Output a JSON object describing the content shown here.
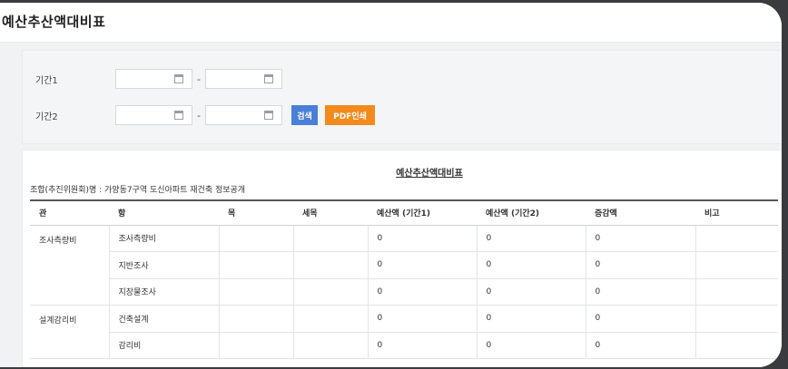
{
  "page": {
    "title": "예산추산액대비표"
  },
  "filter": {
    "period1_label": "기간1",
    "period2_label": "기간2",
    "separator": "-",
    "search_label": "검색",
    "pdf_label": "PDF인쇄"
  },
  "report": {
    "title": "예산추산액대비표",
    "subtitle": "조합(추진위원회)명 : 가양동7구역 도신아파트 재건축 정보공개",
    "columns": [
      "관",
      "항",
      "목",
      "세목",
      "예산액 (기간1)",
      "예산액 (기간2)",
      "증감액",
      "비고"
    ],
    "groups": [
      {
        "name": "조사측량비",
        "rows": [
          {
            "item": "조사측량비",
            "v1": "0",
            "v2": "0",
            "diff": "0"
          },
          {
            "item": "지반조사",
            "v1": "0",
            "v2": "0",
            "diff": "0"
          },
          {
            "item": "지장물조사",
            "v1": "0",
            "v2": "0",
            "diff": "0"
          }
        ]
      },
      {
        "name": "설계감리비",
        "rows": [
          {
            "item": "건축설계",
            "v1": "0",
            "v2": "0",
            "diff": "0"
          },
          {
            "item": "감리비",
            "v1": "0",
            "v2": "0",
            "diff": "0"
          }
        ]
      }
    ]
  }
}
